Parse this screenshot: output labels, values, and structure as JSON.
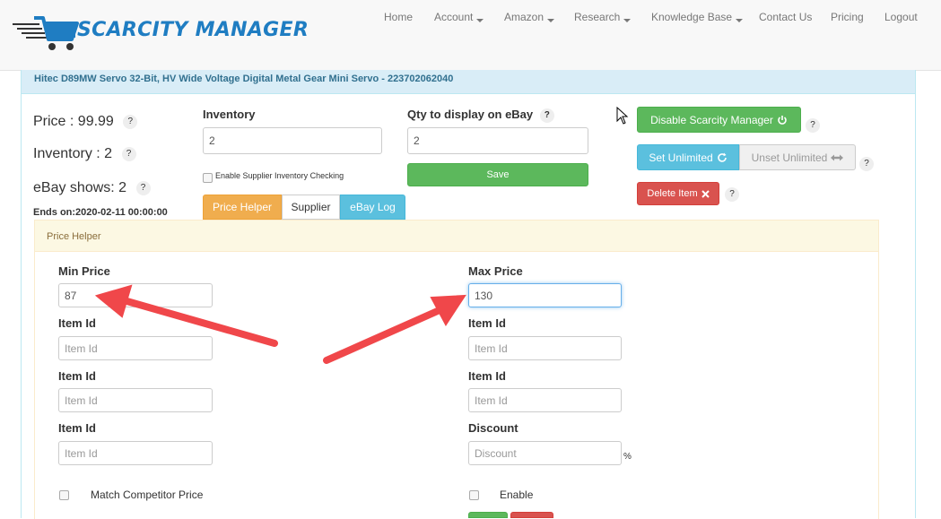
{
  "nav": {
    "brand": "SCARCITY MANAGER",
    "items": [
      {
        "label": "Home",
        "dropdown": false
      },
      {
        "label": "Account",
        "dropdown": true
      },
      {
        "label": "Amazon",
        "dropdown": true
      },
      {
        "label": "Research",
        "dropdown": true
      },
      {
        "label": "Knowledge Base",
        "dropdown": true
      },
      {
        "label": "Contact Us",
        "dropdown": false
      },
      {
        "label": "Pricing",
        "dropdown": false
      },
      {
        "label": "Logout",
        "dropdown": false
      }
    ]
  },
  "product": {
    "title": "Hitec D89MW Servo 32-Bit, HV Wide Voltage Digital Metal Gear Mini Servo - 223702062040"
  },
  "stats": {
    "price": "Price : 99.99",
    "inventory": "Inventory : 2",
    "ebay_shows": "eBay shows: 2",
    "ends_on": "Ends on:2020-02-11 00:00:00",
    "help": "?"
  },
  "inventory": {
    "label": "Inventory",
    "value": "2",
    "supplier_check_label": "Enable Supplier Inventory Checking"
  },
  "qty": {
    "label": "Qty to display on eBay",
    "value": "2",
    "save_label": "Save"
  },
  "actions": {
    "disable_label": "Disable Scarcity Manager",
    "set_unlimited_label": "Set Unlimited",
    "unset_unlimited_label": "Unset Unlimited",
    "delete_label": "Delete Item"
  },
  "tabs": [
    "Price Helper",
    "Supplier",
    "eBay Log"
  ],
  "price_helper": {
    "panel_title": "Price Helper",
    "min_price_label": "Min Price",
    "min_price_value": "87",
    "max_price_label": "Max Price",
    "max_price_value": "130",
    "item_id_label": "Item Id",
    "item_id_placeholder": "Item Id",
    "discount_label": "Discount",
    "discount_placeholder": "Discount",
    "percent": "%",
    "match_competitor_label": "Match Competitor Price",
    "enable_label": "Enable"
  },
  "colors": {
    "brand_blue": "#1f7dc2",
    "annotation_red": "#f0474a",
    "green": "#5cb85c",
    "info": "#5bc0de",
    "danger": "#d9534f",
    "warning": "#f0ad4e"
  }
}
